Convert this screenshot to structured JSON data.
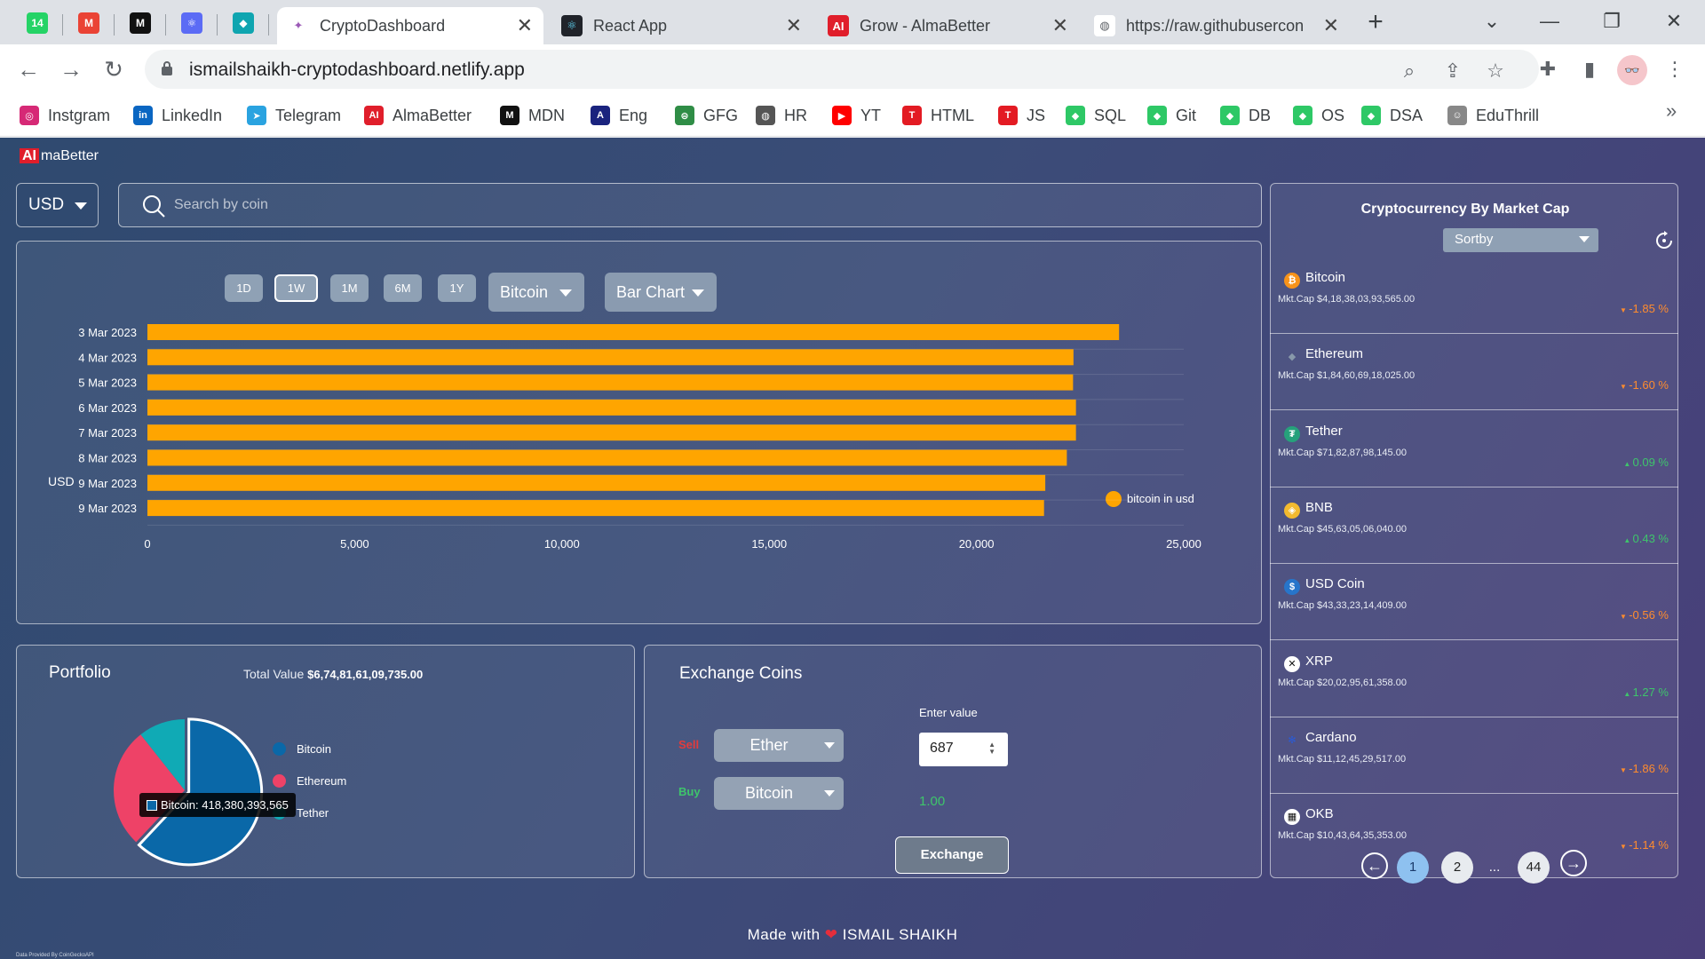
{
  "browser": {
    "pinned_tabs": [
      {
        "icon": "whatsapp-icon",
        "glyph": "14",
        "color": "#25d366"
      },
      {
        "icon": "gmail-icon",
        "glyph": "M",
        "color": "#ea4335"
      },
      {
        "icon": "mdn-icon",
        "glyph": "M",
        "color": "#111111"
      },
      {
        "icon": "react-native-icon",
        "glyph": "⚛",
        "color": "#5b6bf5"
      },
      {
        "icon": "diamond-icon",
        "glyph": "◆",
        "color": "#0fa5b0"
      }
    ],
    "tabs": [
      {
        "label": "CryptoDashboard",
        "icon": "crypto-dashboard-icon",
        "active": true
      },
      {
        "label": "React App",
        "icon": "react-icon",
        "active": false
      },
      {
        "label": "Grow - AlmaBetter",
        "icon": "almabetter-icon",
        "active": false
      },
      {
        "label": "https://raw.githubusercon",
        "icon": "globe-icon",
        "active": false
      }
    ],
    "url": "ismailshaikh-cryptodashboard.netlify.app",
    "bookmarks": [
      {
        "label": "Instgram",
        "icon": "instagram-icon",
        "color": "#d62976",
        "glyph": "◎"
      },
      {
        "label": "LinkedIn",
        "icon": "linkedin-icon",
        "color": "#0a66c2",
        "glyph": "in"
      },
      {
        "label": "Telegram",
        "icon": "telegram-icon",
        "color": "#2aa3e0",
        "glyph": "➤"
      },
      {
        "label": "AlmaBetter",
        "icon": "almabetter-icon",
        "color": "#e01e2b",
        "glyph": "AI"
      },
      {
        "label": "MDN",
        "icon": "mdn-icon",
        "color": "#111111",
        "glyph": "M"
      },
      {
        "label": "Eng",
        "icon": "translate-icon",
        "color": "#1a237e",
        "glyph": "A"
      },
      {
        "label": "GFG",
        "icon": "gfg-icon",
        "color": "#2f8d46",
        "glyph": "⊜"
      },
      {
        "label": "HR",
        "icon": "globe-icon",
        "color": "#555555",
        "glyph": "◍"
      },
      {
        "label": "YT",
        "icon": "youtube-icon",
        "color": "#ff0000",
        "glyph": "▶"
      },
      {
        "label": "HTML",
        "icon": "tutorial-icon",
        "color": "#e31b23",
        "glyph": "T"
      },
      {
        "label": "JS",
        "icon": "tutorial-icon",
        "color": "#e31b23",
        "glyph": "T"
      },
      {
        "label": "SQL",
        "icon": "shield-icon",
        "color": "#2ec866",
        "glyph": "◆"
      },
      {
        "label": "Git",
        "icon": "shield-icon",
        "color": "#2ec866",
        "glyph": "◆"
      },
      {
        "label": "DB",
        "icon": "shield-icon",
        "color": "#2ec866",
        "glyph": "◆"
      },
      {
        "label": "OS",
        "icon": "shield-icon",
        "color": "#2ec866",
        "glyph": "◆"
      },
      {
        "label": "DSA",
        "icon": "shield-icon",
        "color": "#2ec866",
        "glyph": "◆"
      },
      {
        "label": "EduThrill",
        "icon": "eduthrill-icon",
        "color": "#888888",
        "glyph": "☺"
      }
    ]
  },
  "app": {
    "brand_mark": "AI",
    "brand_text": "maBetter",
    "currency": "USD",
    "search_placeholder": "Search by coin",
    "ranges": [
      "1D",
      "1W",
      "1M",
      "6M",
      "1Y"
    ],
    "active_range": "1W",
    "coin_select": "Bitcoin",
    "chart_type_select": "Bar Chart",
    "portfolio": {
      "title": "Portfolio",
      "total_label": "Total Value",
      "total_value": "$6,74,81,61,09,735.00",
      "legend": [
        {
          "label": "Bitcoin",
          "color": "#0a68a8"
        },
        {
          "label": "Ethereum",
          "color": "#ee4267"
        },
        {
          "label": "Tether",
          "color": "#10aab5"
        }
      ],
      "tooltip": "Bitcoin: 418,380,393,565"
    },
    "exchange": {
      "title": "Exchange Coins",
      "sell_label": "Sell",
      "buy_label": "Buy",
      "sell_coin": "Ether",
      "buy_coin": "Bitcoin",
      "enter_label": "Enter value",
      "input_value": "687",
      "result": "1.00",
      "button": "Exchange"
    },
    "market": {
      "title": "Cryptocurrency By Market Cap",
      "sort_label": "Sortby",
      "coins": [
        {
          "name": "Bitcoin",
          "mcap": "Mkt.Cap $4,18,38,03,93,565.00",
          "change": "-1.85 %",
          "dir": "down",
          "icon": "bitcoin-icon",
          "color": "#f7931a",
          "glyph": "₿"
        },
        {
          "name": "Ethereum",
          "mcap": "Mkt.Cap $1,84,60,69,18,025.00",
          "change": "-1.60 %",
          "dir": "down",
          "icon": "ethereum-icon",
          "color": "transparent",
          "glyph": "◆"
        },
        {
          "name": "Tether",
          "mcap": "Mkt.Cap $71,82,87,98,145.00",
          "change": "0.09 %",
          "dir": "up",
          "icon": "tether-icon",
          "color": "#26a17b",
          "glyph": "₮"
        },
        {
          "name": "BNB",
          "mcap": "Mkt.Cap $45,63,05,06,040.00",
          "change": "0.43 %",
          "dir": "up",
          "icon": "bnb-icon",
          "color": "#f3ba2f",
          "glyph": "◈"
        },
        {
          "name": "USD Coin",
          "mcap": "Mkt.Cap $43,33,23,14,409.00",
          "change": "-0.56 %",
          "dir": "down",
          "icon": "usdc-icon",
          "color": "#2775ca",
          "glyph": "$"
        },
        {
          "name": "XRP",
          "mcap": "Mkt.Cap $20,02,95,61,358.00",
          "change": "1.27 %",
          "dir": "up",
          "icon": "xrp-icon",
          "color": "#ffffff",
          "glyph": "✕"
        },
        {
          "name": "Cardano",
          "mcap": "Mkt.Cap $11,12,45,29,517.00",
          "change": "-1.86 %",
          "dir": "down",
          "icon": "cardano-icon",
          "color": "transparent",
          "glyph": "✻"
        },
        {
          "name": "OKB",
          "mcap": "Mkt.Cap $10,43,64,35,353.00",
          "change": "-1.14 %",
          "dir": "down",
          "icon": "okb-icon",
          "color": "#ffffff",
          "glyph": "▦"
        }
      ],
      "pages": [
        "1",
        "2",
        "...",
        "44"
      ],
      "active_page": "1"
    },
    "footer": {
      "prefix": "Made with",
      "author": "ISMAIL SHAIKH"
    },
    "credit": "Data Provided By CoinGeckoAPI"
  },
  "chart_data": {
    "type": "bar",
    "orientation": "horizontal",
    "ylabel": "USD",
    "categories": [
      "3 Mar 2023",
      "4 Mar 2023",
      "5 Mar 2023",
      "6 Mar 2023",
      "7 Mar 2023",
      "8 Mar 2023",
      "9 Mar 2023",
      "9 Mar 2023"
    ],
    "series": [
      {
        "name": "bitcoin in usd",
        "color": "#ffa500",
        "values": [
          23440,
          22340,
          22330,
          22400,
          22400,
          22180,
          21660,
          21630
        ]
      }
    ],
    "xlim": [
      0,
      25000
    ],
    "xticks": [
      "0",
      "5,000",
      "10,000",
      "15,000",
      "20,000",
      "25,000"
    ],
    "legend_position": "top-right",
    "grid": true
  },
  "pie_data": {
    "type": "pie",
    "categories": [
      "Bitcoin",
      "Ethereum",
      "Tether"
    ],
    "values": [
      418380393565,
      184606918025,
      71828798145
    ]
  }
}
